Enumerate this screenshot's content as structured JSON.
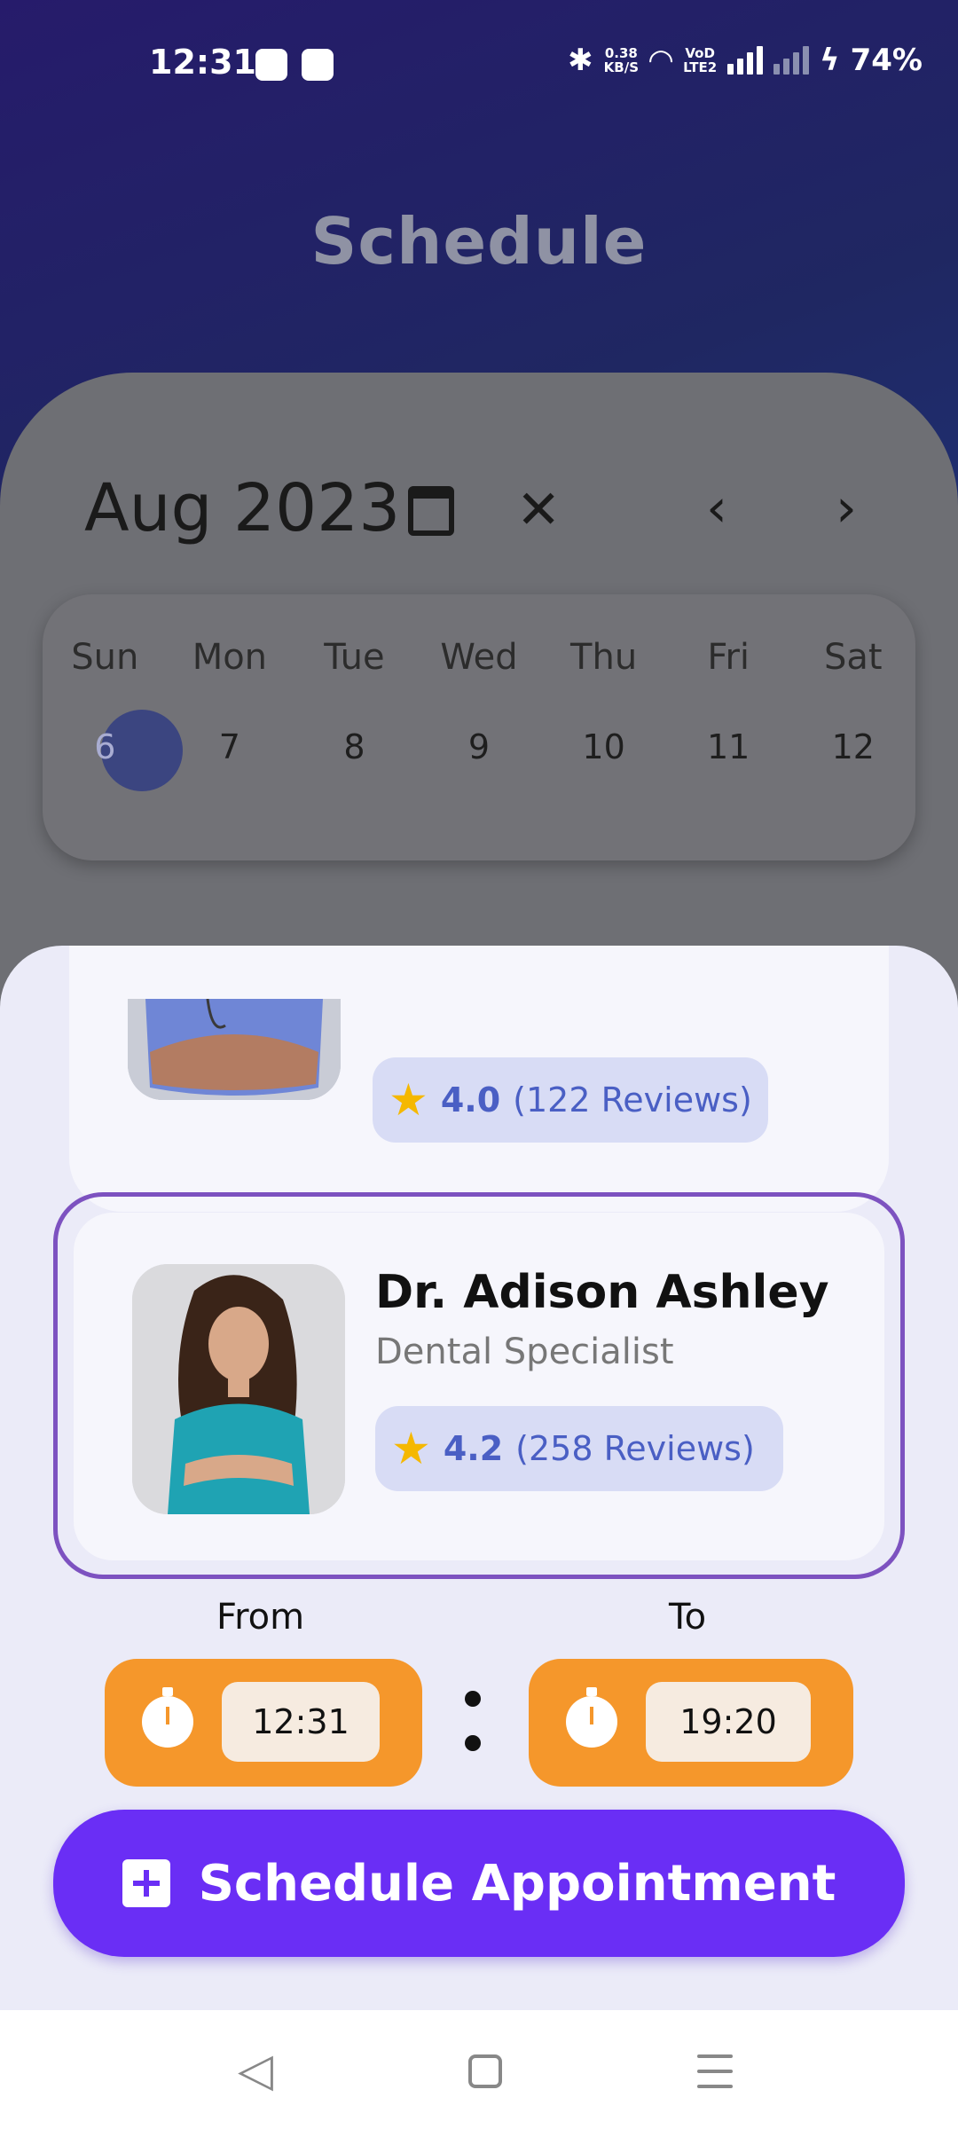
{
  "status_bar": {
    "time": "12:31",
    "net_speed_value": "0.38",
    "net_speed_unit": "KB/S",
    "network_label_top": "VoD",
    "network_label_bottom": "LTE2",
    "battery": "74%"
  },
  "header": {
    "title": "Schedule"
  },
  "calendar": {
    "month": "Aug 2023",
    "week_days": [
      "Sun",
      "Mon",
      "Tue",
      "Wed",
      "Thu",
      "Fri",
      "Sat"
    ],
    "dates": [
      "6",
      "7",
      "8",
      "9",
      "10",
      "11",
      "12"
    ],
    "selected_date": "6"
  },
  "doctors": [
    {
      "rating": "4.0",
      "reviews": "(122 Reviews)"
    },
    {
      "name": "Dr. Adison Ashley",
      "specialty": "Dental Specialist",
      "rating": "4.2",
      "reviews": "(258 Reviews)"
    }
  ],
  "time_range": {
    "from_label": "From",
    "to_label": "To",
    "from_value": "12:31",
    "to_value": "19:20"
  },
  "cta": {
    "label": "Schedule Appointment"
  },
  "colors": {
    "accent": "#6a2ef5",
    "time_box": "#f5972b",
    "selected_border": "#7d52c0",
    "rating_text": "#4a5fc4",
    "star": "#f5b800"
  },
  "icons": [
    "bluetooth-icon",
    "wifi-icon",
    "signal-icon",
    "battery-charging-icon",
    "calendar-icon",
    "close-icon",
    "chevron-left-icon",
    "chevron-right-icon",
    "star-icon",
    "timer-icon",
    "plus-icon",
    "nav-back-icon",
    "nav-home-icon",
    "nav-menu-icon"
  ]
}
